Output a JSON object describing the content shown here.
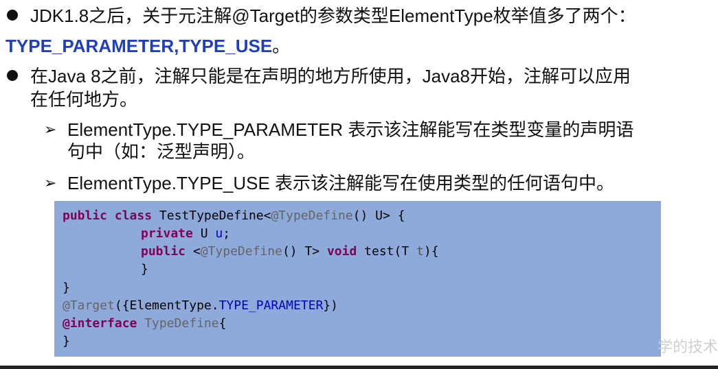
{
  "bullets": [
    {
      "line1": "JDK1.8之后，关于元注解@Target的参数类型ElementType枚举值多了两个：",
      "line2_prefix": "TYPE_PARAMETER,TYPE_USE",
      "line2_suffix": "。"
    },
    {
      "line1": "在Java  8之前，注解只能是在声明的地方所使用，Java8开始，注解可以应用",
      "line2": "在任何地方。"
    }
  ],
  "sub_bullets": [
    {
      "line1": "ElementType.TYPE_PARAMETER  表示该注解能写在类型变量的声明语",
      "line2": "句中（如：泛型声明）。"
    },
    {
      "line1": "ElementType.TYPE_USE 表示该注解能写在使用类型的任何语句中。"
    }
  ],
  "code": {
    "l1_kw1": "public",
    "l1_kw2": "class",
    "l1_name": " TestTypeDefine<",
    "l1_ann": "@TypeDefine",
    "l1_rest": "() U> {",
    "l2_kw": "private",
    "l2_type": " U ",
    "l2_field": "u",
    "l2_end": ";",
    "l3_kw": "public",
    "l3_lt": " <",
    "l3_ann": "@TypeDefine",
    "l3_mid": "() T> ",
    "l3_kw2": "void",
    "l3_name": " test(T ",
    "l3_param": "t",
    "l3_end": "){",
    "l4": "}",
    "l5": "}",
    "l6_ann": "@Target",
    "l6_mid": "({ElementType.",
    "l6_field": "TYPE_PARAMETER",
    "l6_end": "})",
    "l7_kw": "@interface",
    "l7_name": " TypeDefine",
    "l7_end": "{",
    "l8": "}"
  },
  "watermark": "学的技术"
}
